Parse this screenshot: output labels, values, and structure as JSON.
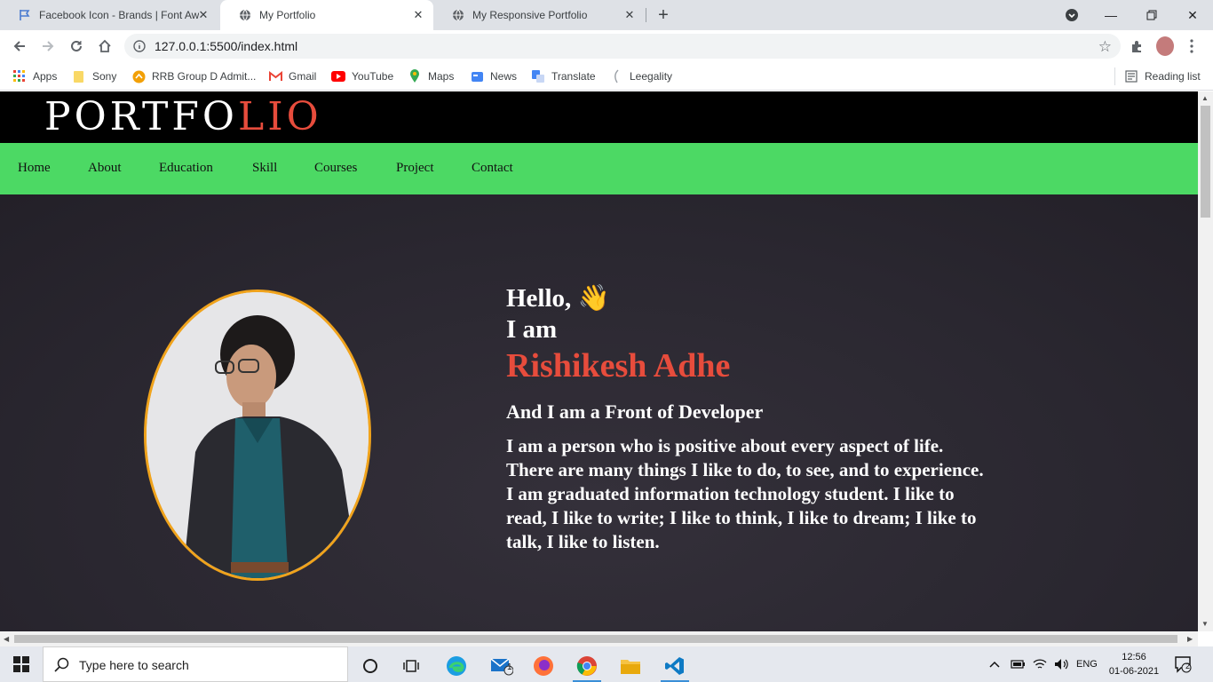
{
  "browser": {
    "tabs": [
      {
        "title": "Facebook Icon - Brands | Font Aw",
        "favicon": "flag-icon",
        "active": false
      },
      {
        "title": "My Portfolio",
        "favicon": "globe-icon",
        "active": true
      },
      {
        "title": "My Responsive Portfolio",
        "favicon": "globe-icon",
        "active": false
      }
    ],
    "url": "127.0.0.1:5500/index.html",
    "bookmarks": [
      {
        "label": "Apps",
        "icon": "apps-grid-icon"
      },
      {
        "label": "Sony",
        "icon": "folder-icon"
      },
      {
        "label": "RRB Group D Admit...",
        "icon": "rrb-icon"
      },
      {
        "label": "Gmail",
        "icon": "gmail-icon"
      },
      {
        "label": "YouTube",
        "icon": "youtube-icon"
      },
      {
        "label": "Maps",
        "icon": "maps-pin-icon"
      },
      {
        "label": "News",
        "icon": "news-icon"
      },
      {
        "label": "Translate",
        "icon": "translate-icon"
      },
      {
        "label": "Leegality",
        "icon": "leegality-icon"
      }
    ],
    "reading_list": "Reading list"
  },
  "site": {
    "logo_main": "PORTFO",
    "logo_accent": "LIO",
    "nav": [
      "Home",
      "About",
      "Education",
      "Skill",
      "Courses",
      "Project",
      "Contact"
    ],
    "hero": {
      "hello": "Hello,",
      "wave": "👋",
      "i_am": "I am",
      "name": "Rishikesh Adhe",
      "role": "And I am a Front of Developer",
      "about": "I am a person who is positive about every aspect of life. There are many things I like to do, to see, and to experience. I am graduated information technology student. I like to read, I like to write; I like to think, I like to dream; I like to talk, I like to listen."
    },
    "colors": {
      "accent": "#e74c3c",
      "nav_bg": "#4cd964",
      "header_bg": "#000000",
      "portrait_border": "#f0a31c"
    }
  },
  "taskbar": {
    "search_placeholder": "Type here to search",
    "mail_badge": "1",
    "language": "ENG",
    "time": "12:56",
    "date": "01-06-2021",
    "notifications": "2"
  }
}
